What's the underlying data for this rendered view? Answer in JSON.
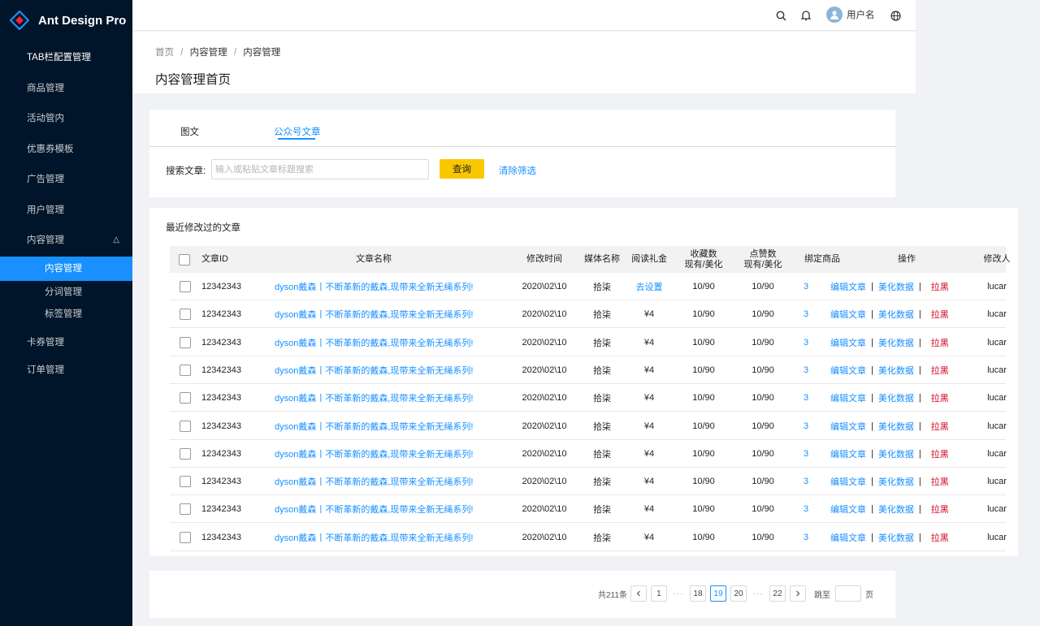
{
  "app": {
    "title": "Ant Design Pro"
  },
  "colors": {
    "sidebar_bg": "#001529",
    "accent": "#1890ff",
    "primary_button": "#fac800",
    "danger": "#d0021b"
  },
  "sidebar": {
    "items": [
      {
        "label": "TAB栏配置管理"
      },
      {
        "label": "商品管理"
      },
      {
        "label": "活动管内"
      },
      {
        "label": "优惠券模板"
      },
      {
        "label": "广告管理"
      },
      {
        "label": "用户管理"
      },
      {
        "label": "内容管理",
        "expanded": true,
        "arrow": "△"
      },
      {
        "label": "内容管理",
        "active": true
      },
      {
        "label": "分词管理"
      },
      {
        "label": "标签管理"
      },
      {
        "label": "卡券管理"
      },
      {
        "label": "订单管理"
      }
    ]
  },
  "header": {
    "user_name": "用户名",
    "icons": [
      "search-icon",
      "bell-icon",
      "avatar",
      "globe-icon"
    ]
  },
  "breadcrumb": {
    "items": [
      "首页",
      "内容管理",
      "内容管理"
    ],
    "separator": "/"
  },
  "page_title": "内容管理首页",
  "tabs": [
    {
      "label": "图文"
    },
    {
      "label": "公众号文章",
      "active": true
    }
  ],
  "filter": {
    "label": "搜索文章:",
    "placeholder": "输入或粘贴文章标题搜索",
    "value": "",
    "query_button": "查询",
    "clear_link": "清除筛选"
  },
  "table": {
    "title": "最近修改过的文章",
    "columns": {
      "id": "文章ID",
      "name": "文章名称",
      "time": "修改时间",
      "media": "媒体名称",
      "gift": "阅读礼金",
      "fav_1": "收藏数",
      "fav_2": "现有/美化",
      "like_1": "点赞数",
      "like_2": "现有/美化",
      "goods": "绑定商品",
      "ops": "操作",
      "editor": "修改人"
    },
    "ops": {
      "edit": "编辑文章",
      "beautify": "美化数据",
      "block": "拉黑",
      "sep": "|"
    },
    "rows": [
      {
        "id": "12342343",
        "name": "dyson戴森丨不断革新的戴森,现带来全新无绳系列!",
        "time": "2020\\02\\10",
        "media": "拾柒",
        "gift": "去设置",
        "fav": "10/90",
        "like": "10/90",
        "goods": "3",
        "editor": "lucar"
      },
      {
        "id": "12342343",
        "name": "dyson戴森丨不断革新的戴森,现带来全新无绳系列!",
        "time": "2020\\02\\10",
        "media": "拾柒",
        "gift": "¥4",
        "fav": "10/90",
        "like": "10/90",
        "goods": "3",
        "editor": "lucar"
      },
      {
        "id": "12342343",
        "name": "dyson戴森丨不断革新的戴森,现带来全新无绳系列!",
        "time": "2020\\02\\10",
        "media": "拾柒",
        "gift": "¥4",
        "fav": "10/90",
        "like": "10/90",
        "goods": "3",
        "editor": "lucar"
      },
      {
        "id": "12342343",
        "name": "dyson戴森丨不断革新的戴森,现带来全新无绳系列!",
        "time": "2020\\02\\10",
        "media": "拾柒",
        "gift": "¥4",
        "fav": "10/90",
        "like": "10/90",
        "goods": "3",
        "editor": "lucar"
      },
      {
        "id": "12342343",
        "name": "dyson戴森丨不断革新的戴森,现带来全新无绳系列!",
        "time": "2020\\02\\10",
        "media": "拾柒",
        "gift": "¥4",
        "fav": "10/90",
        "like": "10/90",
        "goods": "3",
        "editor": "lucar"
      },
      {
        "id": "12342343",
        "name": "dyson戴森丨不断革新的戴森,现带来全新无绳系列!",
        "time": "2020\\02\\10",
        "media": "拾柒",
        "gift": "¥4",
        "fav": "10/90",
        "like": "10/90",
        "goods": "3",
        "editor": "lucar"
      },
      {
        "id": "12342343",
        "name": "dyson戴森丨不断革新的戴森,现带来全新无绳系列!",
        "time": "2020\\02\\10",
        "media": "拾柒",
        "gift": "¥4",
        "fav": "10/90",
        "like": "10/90",
        "goods": "3",
        "editor": "lucar"
      },
      {
        "id": "12342343",
        "name": "dyson戴森丨不断革新的戴森,现带来全新无绳系列!",
        "time": "2020\\02\\10",
        "media": "拾柒",
        "gift": "¥4",
        "fav": "10/90",
        "like": "10/90",
        "goods": "3",
        "editor": "lucar"
      },
      {
        "id": "12342343",
        "name": "dyson戴森丨不断革新的戴森,现带来全新无绳系列!",
        "time": "2020\\02\\10",
        "media": "拾柒",
        "gift": "¥4",
        "fav": "10/90",
        "like": "10/90",
        "goods": "3",
        "editor": "lucar"
      },
      {
        "id": "12342343",
        "name": "dyson戴森丨不断革新的戴森,现带来全新无绳系列!",
        "time": "2020\\02\\10",
        "media": "拾柒",
        "gift": "¥4",
        "fav": "10/90",
        "like": "10/90",
        "goods": "3",
        "editor": "lucar"
      }
    ]
  },
  "pagination": {
    "total_text": "共211条",
    "prev": "<",
    "next": ">",
    "pages": [
      "1",
      "18",
      "19",
      "20",
      "22"
    ],
    "current": "19",
    "ellipsis": "···",
    "jump_label": "跳至",
    "jump_suffix": "页"
  }
}
